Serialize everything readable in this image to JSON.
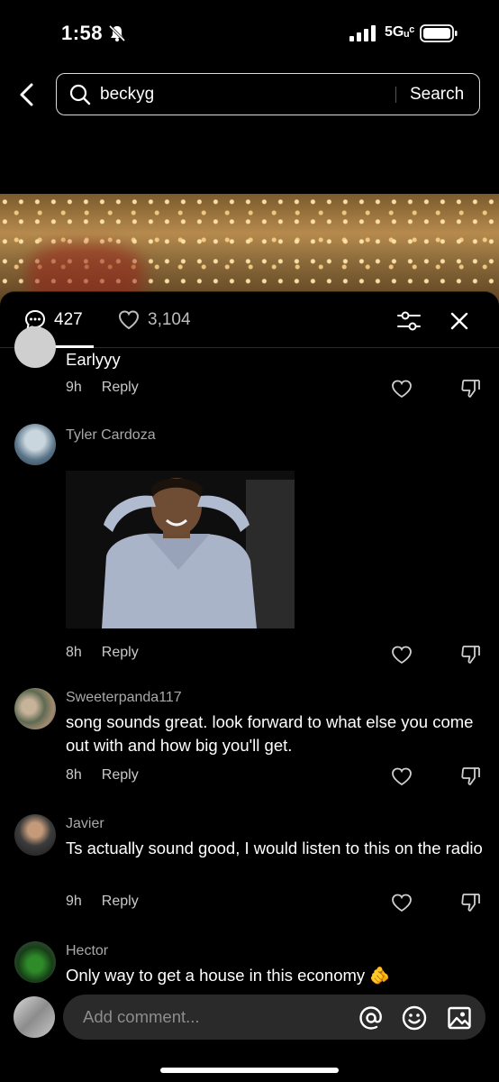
{
  "status": {
    "time": "1:58",
    "network": "5Gᵤᶜ"
  },
  "search": {
    "query": "beckyg",
    "button_label": "Search"
  },
  "sheet": {
    "comments_count": "427",
    "likes_count": "3,104"
  },
  "comments": [
    {
      "username": "",
      "text": "Earlyyy",
      "time": "9h",
      "reply_label": "Reply"
    },
    {
      "username": "Tyler Cardoza",
      "text": "",
      "time": "8h",
      "reply_label": "Reply"
    },
    {
      "username": "Sweeterpanda117",
      "text": "song sounds great. look forward to what else you come out with and how big you'll get.",
      "time": "8h",
      "reply_label": "Reply"
    },
    {
      "username": "Javier",
      "text": "Ts actually sound good, I would listen to this on the radio",
      "time": "9h",
      "reply_label": "Reply"
    },
    {
      "username": "Hector",
      "text": "Only way to get a house in this economy 🫵",
      "time": "",
      "reply_label": ""
    }
  ],
  "composer": {
    "placeholder": "Add comment..."
  },
  "icons": {
    "back": "chevron-left-icon",
    "search": "search-icon",
    "comments": "speech-bubble-icon",
    "likes": "heart-icon",
    "filter": "sliders-icon",
    "close": "close-icon",
    "dislike": "thumbs-down-icon",
    "at": "at-sign-icon",
    "emoji": "smiley-icon",
    "image": "image-icon"
  }
}
